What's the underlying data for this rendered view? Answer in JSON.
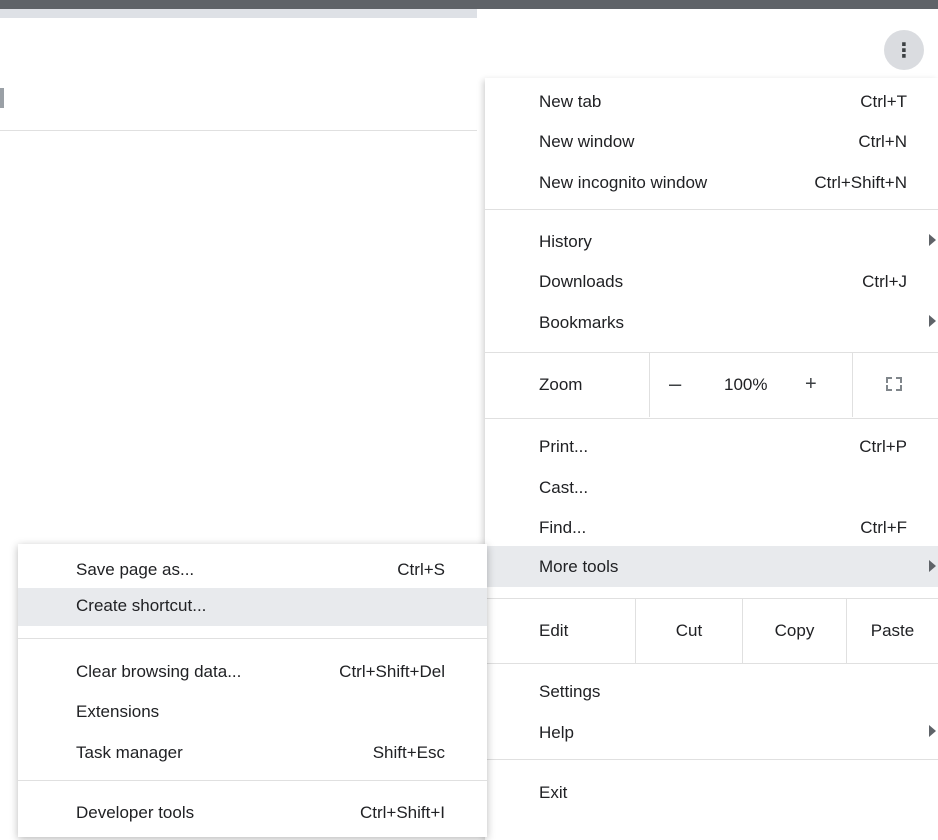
{
  "menu_button": {
    "icon": "kebab-menu-icon",
    "glyph": "⋮"
  },
  "menu": {
    "new_tab": {
      "label": "New tab",
      "shortcut": "Ctrl+T"
    },
    "new_window": {
      "label": "New window",
      "shortcut": "Ctrl+N"
    },
    "new_incognito": {
      "label": "New incognito window",
      "shortcut": "Ctrl+Shift+N"
    },
    "history": {
      "label": "History"
    },
    "downloads": {
      "label": "Downloads",
      "shortcut": "Ctrl+J"
    },
    "bookmarks": {
      "label": "Bookmarks"
    },
    "zoom": {
      "label": "Zoom",
      "minus": "–",
      "value": "100%",
      "plus": "+"
    },
    "print": {
      "label": "Print...",
      "shortcut": "Ctrl+P"
    },
    "cast": {
      "label": "Cast..."
    },
    "find": {
      "label": "Find...",
      "shortcut": "Ctrl+F"
    },
    "more_tools": {
      "label": "More tools"
    },
    "edit": {
      "label": "Edit",
      "cut": "Cut",
      "copy": "Copy",
      "paste": "Paste"
    },
    "settings": {
      "label": "Settings"
    },
    "help": {
      "label": "Help"
    },
    "exit": {
      "label": "Exit"
    }
  },
  "submenu": {
    "save_page": {
      "label": "Save page as...",
      "shortcut": "Ctrl+S"
    },
    "create_shortcut": {
      "label": "Create shortcut..."
    },
    "clear_browsing": {
      "label": "Clear browsing data...",
      "shortcut": "Ctrl+Shift+Del"
    },
    "extensions": {
      "label": "Extensions"
    },
    "task_manager": {
      "label": "Task manager",
      "shortcut": "Shift+Esc"
    },
    "developer_tools": {
      "label": "Developer tools",
      "shortcut": "Ctrl+Shift+I"
    }
  },
  "colors": {
    "highlight": "#e8eaed",
    "separator": "#e0e0e0",
    "text": "#202124"
  }
}
